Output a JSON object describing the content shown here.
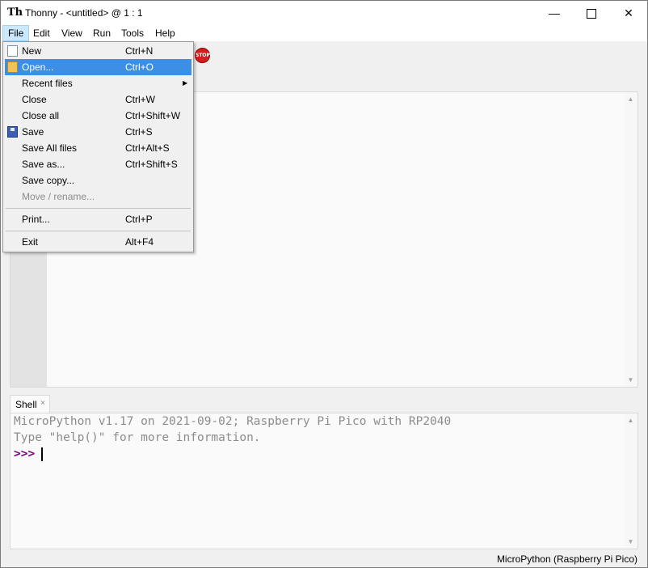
{
  "window": {
    "app_name": "Thonny",
    "title": "Thonny  -  <untitled>  @  1 : 1",
    "app_icon": "Th",
    "min_glyph": "—",
    "close_glyph": "✕"
  },
  "menubar": {
    "items": [
      "File",
      "Edit",
      "View",
      "Run",
      "Tools",
      "Help"
    ],
    "active": "File"
  },
  "toolbar": {
    "stop_icon_text": "STOP",
    "stop_color": "#d31f1f"
  },
  "file_menu": {
    "items": [
      {
        "label": "New",
        "shortcut": "Ctrl+N",
        "icon": "new-file-icon"
      },
      {
        "label": "Open...",
        "shortcut": "Ctrl+O",
        "icon": "open-folder-icon",
        "highlighted": true
      },
      {
        "label": "Recent files",
        "shortcut": "",
        "submenu": true
      },
      {
        "label": "Close",
        "shortcut": "Ctrl+W"
      },
      {
        "label": "Close all",
        "shortcut": "Ctrl+Shift+W"
      },
      {
        "label": "Save",
        "shortcut": "Ctrl+S",
        "icon": "save-disk-icon"
      },
      {
        "label": "Save All files",
        "shortcut": "Ctrl+Alt+S"
      },
      {
        "label": "Save as...",
        "shortcut": "Ctrl+Shift+S"
      },
      {
        "label": "Save copy...",
        "shortcut": ""
      },
      {
        "label": "Move / rename...",
        "shortcut": "",
        "disabled": true
      },
      {
        "label": "Print...",
        "shortcut": "Ctrl+P"
      },
      {
        "label": "Exit",
        "shortcut": "Alt+F4"
      }
    ],
    "highlight_color": "#3d8ee5",
    "submenu_arrow": "▶"
  },
  "shell": {
    "tab_label": "Shell",
    "tab_close": "×",
    "banner_line1": "MicroPython v1.17 on 2021-09-02; Raspberry Pi Pico with RP2040",
    "banner_line2": "Type \"help()\" for more information.",
    "prompt": ">>>",
    "prompt_color": "#800080"
  },
  "editor": {
    "scroll_up": "▲",
    "scroll_down": "▼"
  },
  "statusbar": {
    "interpreter": "MicroPython (Raspberry Pi Pico)"
  }
}
